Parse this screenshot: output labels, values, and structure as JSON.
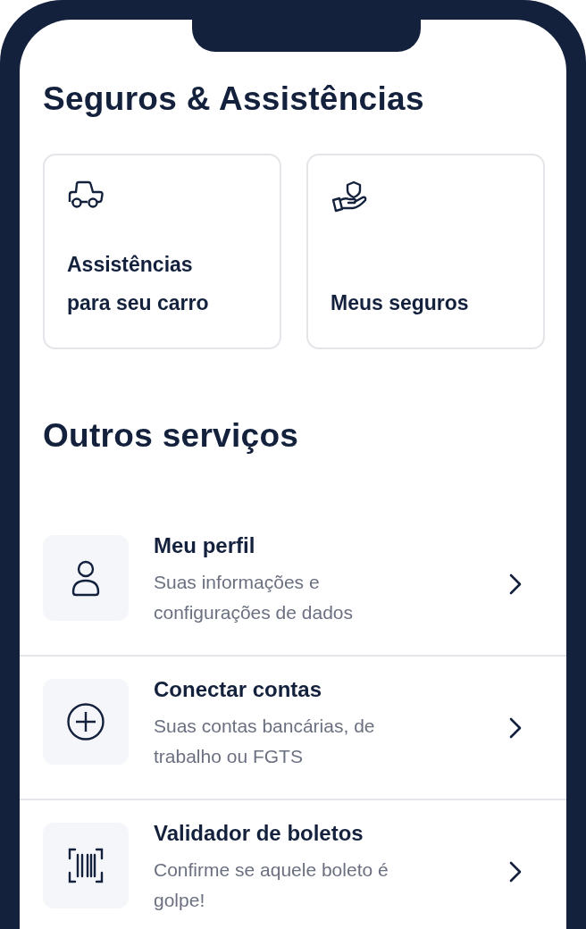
{
  "insurance_section": {
    "title": "Seguros & Assistências",
    "cards": [
      {
        "label": "Assistências para seu carro"
      },
      {
        "label": "Meus seguros"
      }
    ]
  },
  "services_section": {
    "title": "Outros serviços",
    "items": [
      {
        "title": "Meu perfil",
        "description": "Suas informações e configurações de dados"
      },
      {
        "title": "Conectar contas",
        "description": "Suas contas bancárias, de trabalho ou FGTS"
      },
      {
        "title": "Validador de boletos",
        "description": "Confirme se aquele boleto é golpe!"
      }
    ]
  }
}
